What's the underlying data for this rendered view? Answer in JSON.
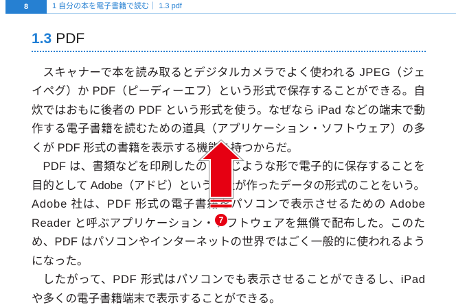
{
  "header": {
    "page_number": "8",
    "running_title": "1 自分の本を電子書籍で読む｜ 1.3 pdf",
    "accent_color": "#2680d2"
  },
  "section": {
    "number": "1.3",
    "title": "PDF",
    "number_color": "#1f7fd6"
  },
  "body": {
    "text_color": "#231f20",
    "paragraphs": [
      {
        "lines": [
          "スキャナーで本を読み取るとデジタルカメラでよく使われる JPEG（ジェ",
          "イペグ）か PDF（ピーディーエフ）という形式で保存することができる。自",
          "炊ではおもに後者の PDF という形式を使う。なぜなら iPad などの端末で動",
          "作する電子書籍を読むための道具（アプリケーション・ソフトウェア）の多",
          "くが PDF 形式の書籍を表示する機能を持つからだ。"
        ]
      },
      {
        "lines": [
          "PDF は、書類などを印刷したのと同じような形で電子的に保存することを",
          "目的として Adobe（アドビ）という会社が作ったデータの形式のことをいう。",
          "Adobe 社は、PDF 形式の電子書籍をパソコンで表示させるための Adobe",
          "Reader と呼ぶアプリケーション・ソフトウェアを無償で配布した。このた",
          "め、PDF はパソコンやインターネットの世界ではごく一般的に使われるよう",
          "になった。"
        ]
      },
      {
        "lines": [
          "したがって、PDF 形式はパソコンでも表示させることができるし、iPad",
          "や多くの電子書籍端末で表示することができる。"
        ]
      }
    ]
  },
  "annotation": {
    "icon": "up-arrow-icon",
    "marker_number": "7",
    "color": "#e60012"
  }
}
